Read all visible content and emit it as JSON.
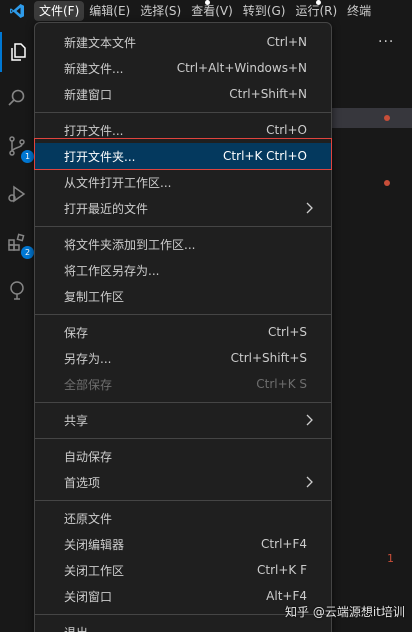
{
  "menubar": {
    "items": [
      {
        "label": "文件(F)",
        "active": true
      },
      {
        "label": "编辑(E)"
      },
      {
        "label": "选择(S)"
      },
      {
        "label": "查看(V)"
      },
      {
        "label": "转到(G)"
      },
      {
        "label": "运行(R)"
      },
      {
        "label": "终端"
      }
    ]
  },
  "activity_bar": {
    "icons": [
      "explorer-icon",
      "search-icon",
      "source-control-icon",
      "run-debug-icon",
      "extensions-icon",
      "remote-explorer-icon"
    ],
    "badges": {
      "source_control": "1",
      "extensions": "2"
    }
  },
  "sidebar": {
    "more_label": "···",
    "problem_count": "1"
  },
  "file_menu": {
    "groups": [
      [
        {
          "label": "新建文本文件",
          "shortcut": "Ctrl+N"
        },
        {
          "label": "新建文件...",
          "shortcut": "Ctrl+Alt+Windows+N"
        },
        {
          "label": "新建窗口",
          "shortcut": "Ctrl+Shift+N"
        }
      ],
      [
        {
          "label": "打开文件...",
          "shortcut": "Ctrl+O"
        },
        {
          "label": "打开文件夹...",
          "shortcut": "Ctrl+K Ctrl+O",
          "highlighted": true
        },
        {
          "label": "从文件打开工作区..."
        },
        {
          "label": "打开最近的文件",
          "submenu": true
        }
      ],
      [
        {
          "label": "将文件夹添加到工作区..."
        },
        {
          "label": "将工作区另存为..."
        },
        {
          "label": "复制工作区"
        }
      ],
      [
        {
          "label": "保存",
          "shortcut": "Ctrl+S"
        },
        {
          "label": "另存为...",
          "shortcut": "Ctrl+Shift+S"
        },
        {
          "label": "全部保存",
          "shortcut": "Ctrl+K S",
          "disabled": true
        }
      ],
      [
        {
          "label": "共享",
          "submenu": true
        }
      ],
      [
        {
          "label": "自动保存"
        },
        {
          "label": "首选项",
          "submenu": true
        }
      ],
      [
        {
          "label": "还原文件"
        },
        {
          "label": "关闭编辑器",
          "shortcut": "Ctrl+F4"
        },
        {
          "label": "关闭工作区",
          "shortcut": "Ctrl+K F"
        },
        {
          "label": "关闭窗口",
          "shortcut": "Alt+F4"
        }
      ],
      [
        {
          "label": "退出"
        }
      ]
    ]
  },
  "watermark": "知乎 @云端源想it培训",
  "colors": {
    "accent": "#0078d4",
    "highlight": "#04395e",
    "outline": "#e0443e",
    "modified": "#c74e39"
  }
}
